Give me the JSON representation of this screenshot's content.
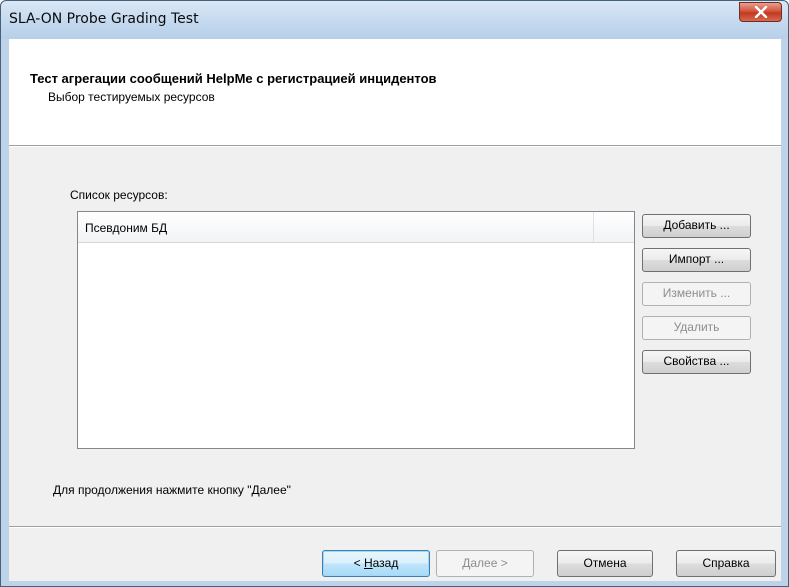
{
  "window": {
    "title": "SLA-ON Probe Grading Test"
  },
  "header": {
    "title": "Тест агрегации сообщений HelpMe с регистрацией инцидентов",
    "subtitle": "Выбор тестируемых ресурсов"
  },
  "resources": {
    "label": "Список ресурсов:",
    "columns": [
      "Псевдоним БД"
    ],
    "rows": []
  },
  "side_buttons": {
    "add": "Добавить ...",
    "import": "Импорт ...",
    "edit": "Изменить ...",
    "delete": "Удалить",
    "properties": "Свойства ..."
  },
  "hint": "Для продолжения нажмите кнопку \"Далее\"",
  "footer": {
    "back_prefix": "< ",
    "back_mnemonic": "Н",
    "back_rest": "азад",
    "next_mnemonic": "Д",
    "next_rest": "алее >",
    "cancel": "Отмена",
    "help": "Справка"
  },
  "icons": {
    "close": "close-icon"
  },
  "colors": {
    "close_button": "#c0391f",
    "titlebar": "#c3d8ee",
    "dialog_face": "#f0f0f0",
    "default_button_border": "#3c7fb1"
  }
}
